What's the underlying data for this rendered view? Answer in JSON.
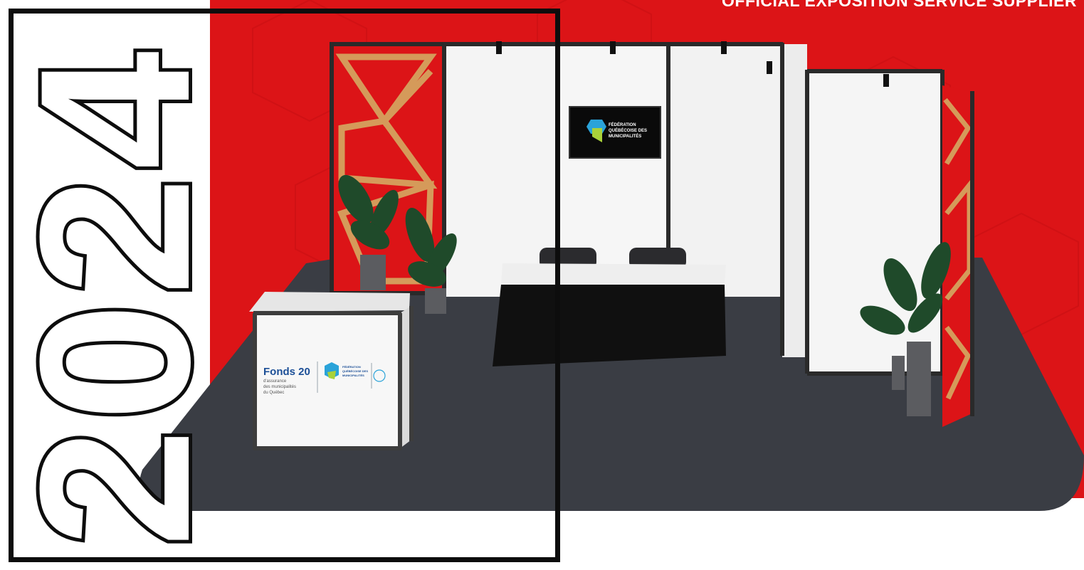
{
  "header": {
    "title": "OFFICIAL EXPOSITION SERVICE SUPPLIER"
  },
  "year": "2024",
  "tv_screen": {
    "line1": "FÉDÉRATION",
    "line2": "QUÉBÉCOISE DES",
    "line3": "MUNICIPALITÉS"
  },
  "counter": {
    "brand": "Fonds 20",
    "sub1": "d'assurance",
    "sub2": "des municipalités",
    "sub3": "du Québec",
    "fqm1": "FÉDÉRATION",
    "fqm2": "QUÉBÉCOISE DES",
    "fqm3": "MUNICIPALITÉS"
  },
  "colors": {
    "brand_red": "#dc1417",
    "carpet": "#3a3d44",
    "panel": "#f4f4f4",
    "frame": "#1a1a1a",
    "lattice": "#d59a5a"
  }
}
